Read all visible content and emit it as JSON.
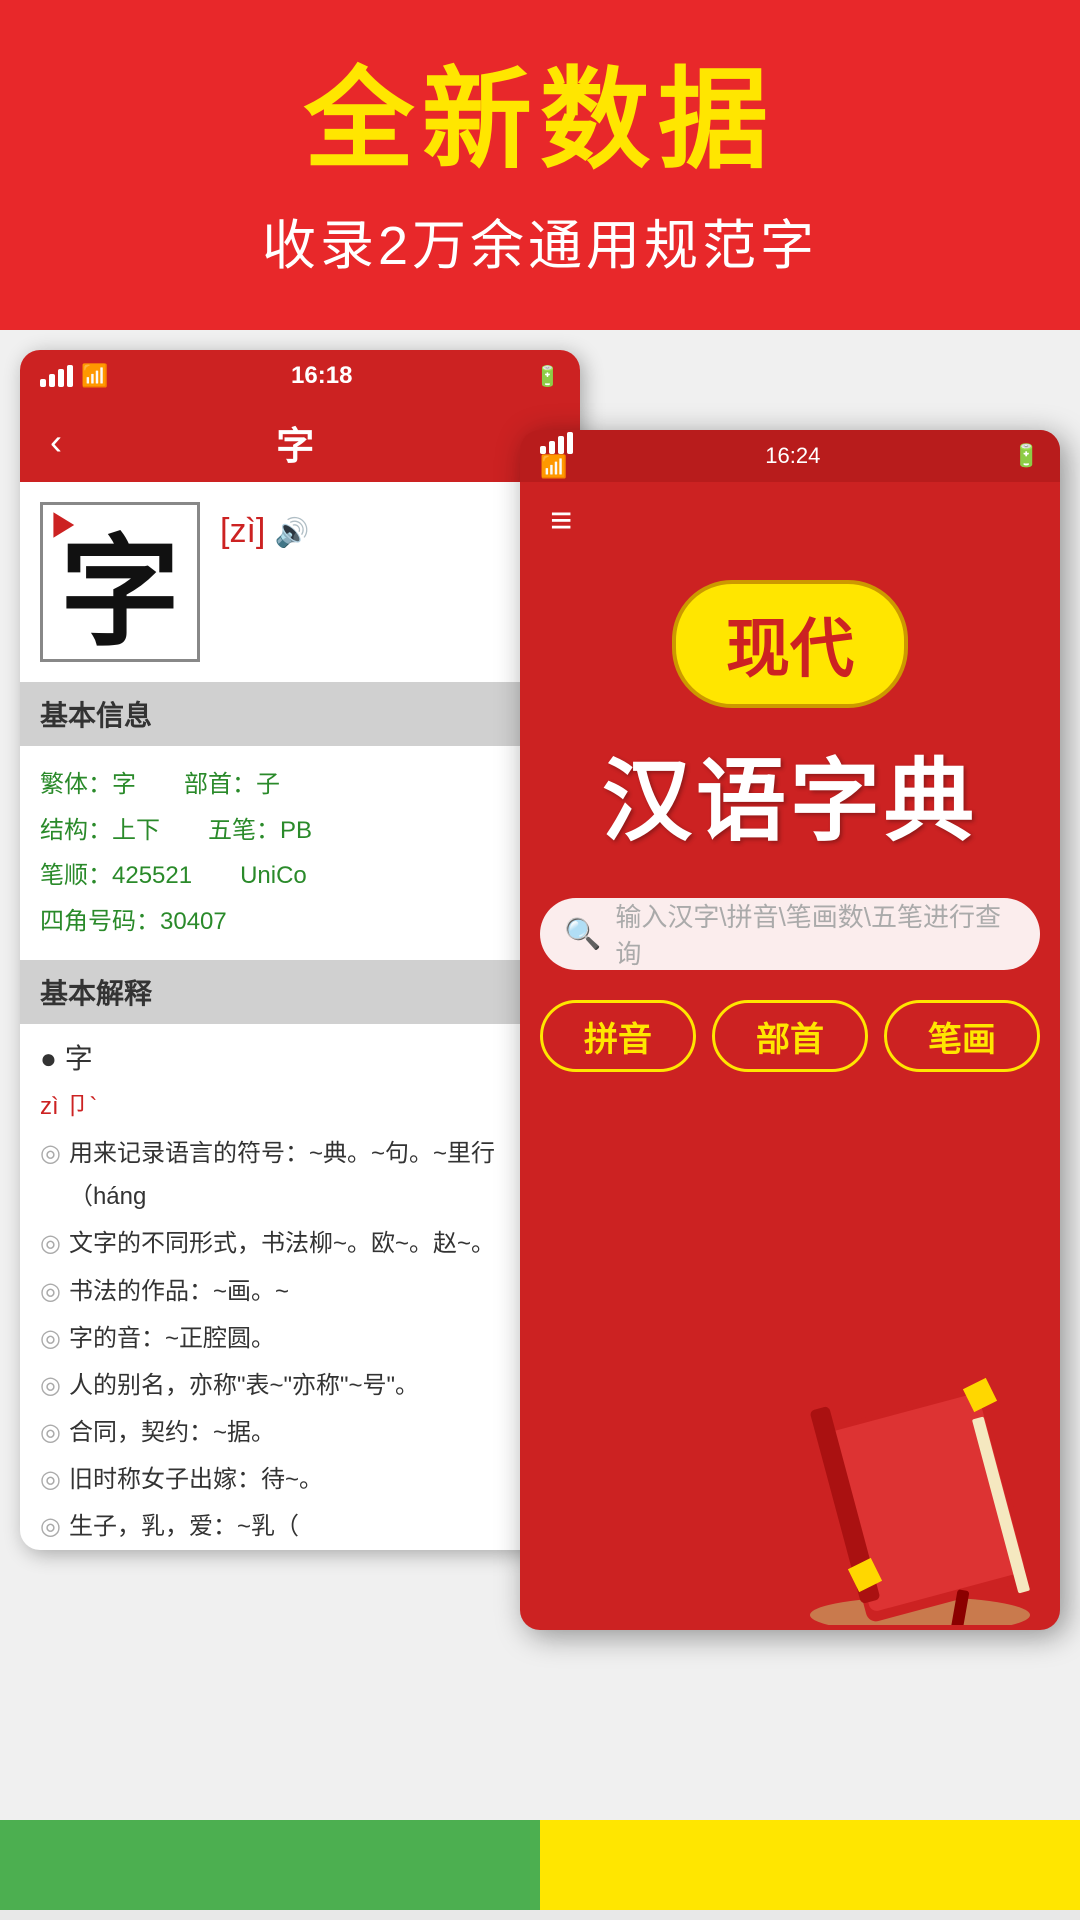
{
  "header": {
    "main_title": "全新数据",
    "sub_title": "收录2万余通用规范字"
  },
  "phone_back": {
    "status_bar": {
      "time": "16:18"
    },
    "nav": {
      "title": "字",
      "back": "‹",
      "heart": "♥"
    },
    "char": {
      "display": "字",
      "pronunciation": "[zì]",
      "speaker": "🔊"
    },
    "basic_info_header": "基本信息",
    "info": {
      "traditional": "繁体：字",
      "radical": "部首：子",
      "structure": "结构：上下",
      "wubi": "五笔：PB",
      "stroke_order": "笔顺：425521",
      "unicode": "UniCo",
      "four_corner": "四角号码：30407"
    },
    "basic_explanation_header": "基本解释",
    "explanations": [
      "● 字",
      "zì 卩`",
      "◎ 用来记录语言的符号：~典。~句。~里行（háng",
      "◎ 文字的不同形式，书法柳~。欧~。赵~。",
      "◎ 书法的作品：~画。~",
      "◎ 字的音：~正腔圆。",
      "◎ 人的别名，亦称\"表~\"亦称\"~号\"。",
      "◎ 合同，契约：~据。",
      "◎ 旧时称女子出嫁：待~。",
      "◎ 生子，乳，爱：~乳（"
    ]
  },
  "phone_front": {
    "status_bar": {
      "time": "16:24"
    },
    "menu_icon": "≡",
    "badge_text": "现代",
    "app_title": "汉语字典",
    "search_placeholder": "输入汉字\\拼音\\笔画数\\五笔进行查询",
    "buttons": [
      "拼音",
      "部首",
      "笔画"
    ]
  },
  "colors": {
    "red": "#e8282a",
    "dark_red": "#cc2222",
    "yellow": "#FFE600",
    "white": "#ffffff",
    "green": "#2a8a2a"
  }
}
